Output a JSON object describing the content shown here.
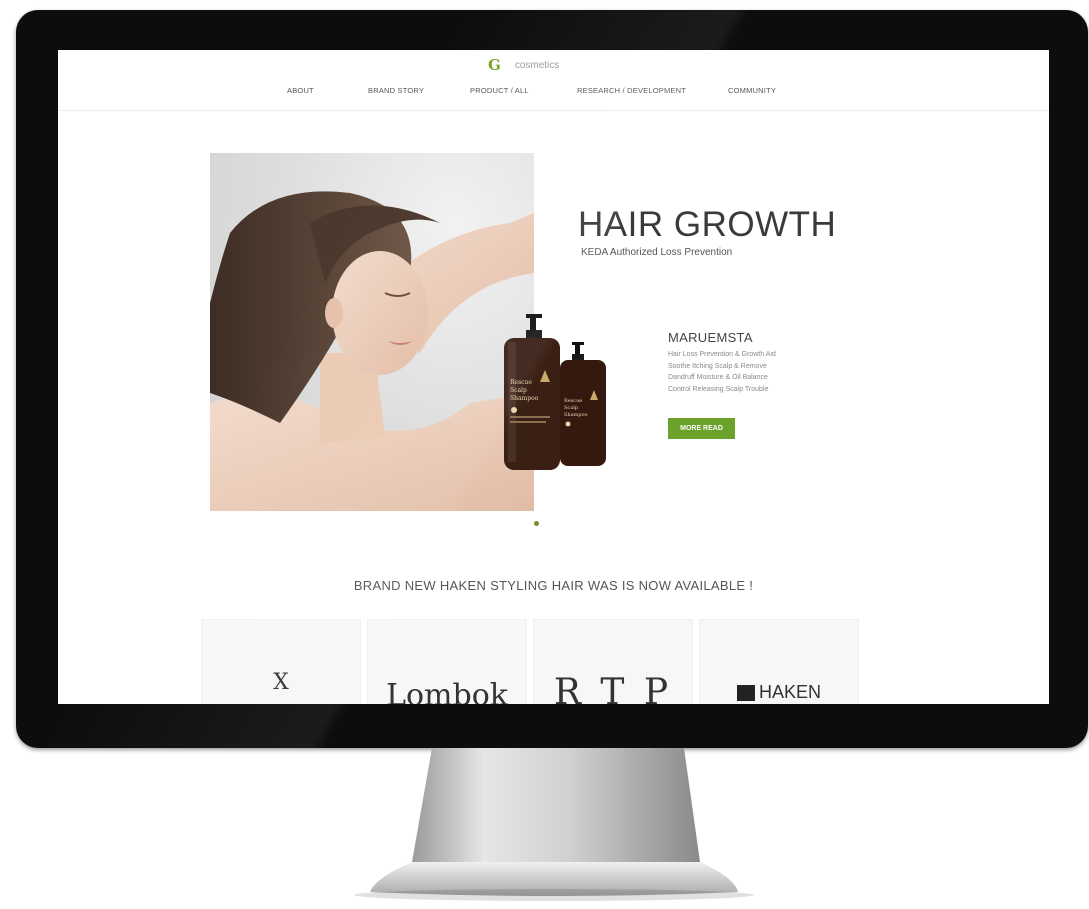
{
  "site": {
    "logo_mark": "G",
    "logo_text": "cosmetics"
  },
  "nav": [
    {
      "label": "ABOUT"
    },
    {
      "label": "BRAND STORY"
    },
    {
      "label": "PRODUCT / ALL"
    },
    {
      "label": "RESEARCH / DEVELOPMENT"
    },
    {
      "label": "COMMUNITY"
    }
  ],
  "hero": {
    "title": "HAIR GROWTH",
    "subtitle": "KEDA Authorized Loss Prevention",
    "product_name": "MARUEMSTA",
    "features": [
      "Hair Loss Prevention & Growth Aid",
      "Soothe Itching Scalp & Remove",
      "Dandruff Moisture & Oil Balance",
      "Control Releasing Scalp Trouble"
    ],
    "button_label": "MORE READ",
    "bottle_label_large": "Rescue Scalp Shampoo",
    "bottle_label_small": "Rescue Scalp Shampoo"
  },
  "announcement": "BRAND NEW HAKEN STYLING HAIR WAS IS NOW AVAILABLE !",
  "brands": [
    {
      "label": "X"
    },
    {
      "label": "Lombok"
    },
    {
      "label": "R T P"
    },
    {
      "label": "HAKEN"
    }
  ],
  "colors": {
    "accent": "#6aa22c",
    "bezel": "#0d0d0d"
  }
}
